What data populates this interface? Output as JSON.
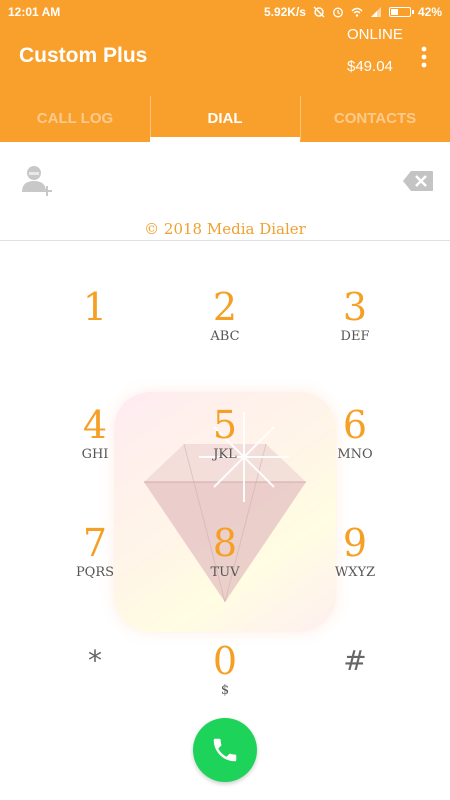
{
  "status_bar": {
    "time": "12:01 AM",
    "network_speed": "5.92K/s",
    "battery": "42%",
    "battery_level": 0.42,
    "icons": [
      "sync-off-icon",
      "alarm-icon",
      "wifi-icon",
      "signal-icon",
      "battery-icon"
    ]
  },
  "app_bar": {
    "title": "Custom Plus",
    "status": "ONLINE",
    "balance": "$49.04",
    "menu_icon": "more-vert-icon"
  },
  "tabs": [
    {
      "label": "CALL LOG",
      "active": false
    },
    {
      "label": "DIAL",
      "active": true
    },
    {
      "label": "CONTACTS",
      "active": false
    }
  ],
  "dialer": {
    "number_value": "",
    "copyright": "© 2018 Media Dialer",
    "add_contact_icon": "add-contact-icon",
    "backspace_icon": "backspace-icon"
  },
  "keypad": [
    {
      "digit": "1",
      "letters": ""
    },
    {
      "digit": "2",
      "letters": "ABC"
    },
    {
      "digit": "3",
      "letters": "DEF"
    },
    {
      "digit": "4",
      "letters": "GHI"
    },
    {
      "digit": "5",
      "letters": "JKL"
    },
    {
      "digit": "6",
      "letters": "MNO"
    },
    {
      "digit": "7",
      "letters": "PQRS"
    },
    {
      "digit": "8",
      "letters": "TUV"
    },
    {
      "digit": "9",
      "letters": "WXYZ"
    },
    {
      "digit": "*",
      "letters": ""
    },
    {
      "digit": "0",
      "letters": "$"
    },
    {
      "digit": "#",
      "letters": ""
    }
  ],
  "call_button": {
    "icon": "phone-icon"
  },
  "colors": {
    "brand": "#f9a02c",
    "digit": "#f5a024",
    "call": "#1ed35a"
  }
}
